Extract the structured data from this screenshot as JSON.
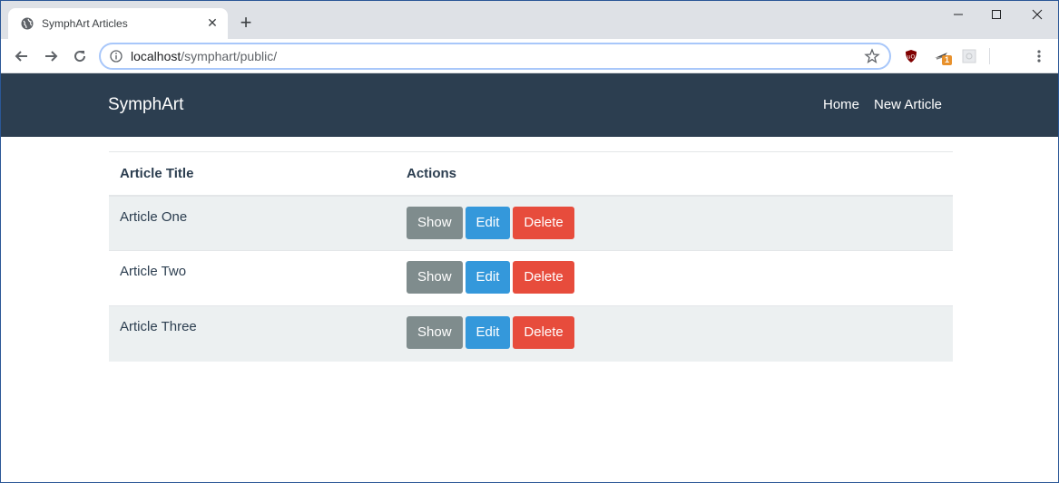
{
  "browser": {
    "tab_title": "SymphArt Articles",
    "url_host": "localhost",
    "url_path": "/symphart/public/",
    "extension_badge": "1"
  },
  "page": {
    "brand": "SymphArt",
    "nav": [
      {
        "label": "Home"
      },
      {
        "label": "New Article"
      }
    ],
    "table": {
      "headers": [
        "Article Title",
        "Actions"
      ],
      "rows": [
        {
          "title": "Article One",
          "show": "Show",
          "edit": "Edit",
          "delete": "Delete"
        },
        {
          "title": "Article Two",
          "show": "Show",
          "edit": "Edit",
          "delete": "Delete"
        },
        {
          "title": "Article Three",
          "show": "Show",
          "edit": "Edit",
          "delete": "Delete"
        }
      ]
    }
  },
  "colors": {
    "navbar": "#2c3e50",
    "show": "#7f8c8d",
    "edit": "#3498db",
    "delete": "#e74c3c",
    "stripe": "#ecf0f1"
  }
}
